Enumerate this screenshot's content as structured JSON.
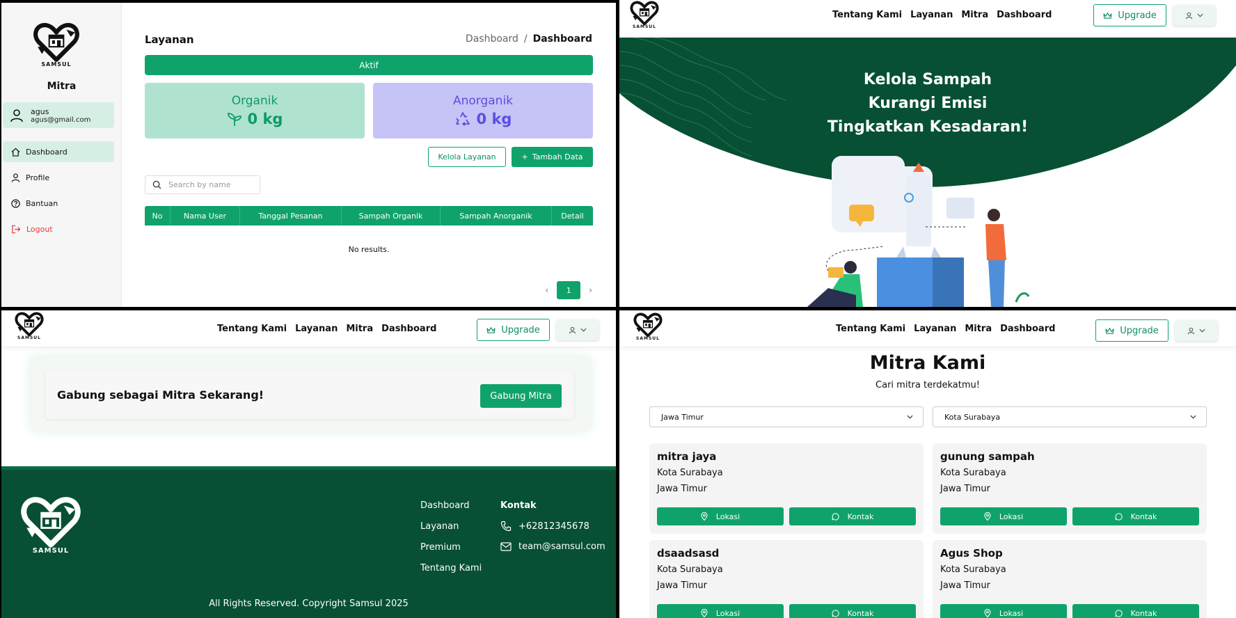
{
  "brand": {
    "name": "SAMSUL",
    "primary": "#0fa36b",
    "dark": "#075033"
  },
  "dashboard": {
    "role": "Mitra",
    "user": {
      "name": "agus",
      "email": "agus@gmail.com"
    },
    "sidebar": [
      {
        "label": "Dashboard",
        "icon": "home-icon"
      },
      {
        "label": "Profile",
        "icon": "user-icon"
      },
      {
        "label": "Bantuan",
        "icon": "help-icon"
      },
      {
        "label": "Logout",
        "icon": "logout-icon"
      }
    ],
    "title": "Layanan",
    "breadcrumb": [
      "Dashboard",
      "Dashboard"
    ],
    "breadcrumb_sep": "/",
    "status_bar": "Aktif",
    "stats": {
      "organik": {
        "label": "Organik",
        "value": "0 kg"
      },
      "anorganik": {
        "label": "Anorganik",
        "value": "0 kg"
      }
    },
    "buttons": {
      "kelola": "Kelola Layanan",
      "tambah": "Tambah Data"
    },
    "search_placeholder": "Search by name",
    "table": {
      "columns": [
        "No",
        "Nama User",
        "Tanggal Pesanan",
        "Sampah Organik",
        "Sampah Anorganik",
        "Detail"
      ],
      "rows": [],
      "empty": "No results."
    },
    "pagination": {
      "current": "1",
      "prev": "‹",
      "next": "›"
    }
  },
  "nav": {
    "links": [
      "Tentang Kami",
      "Layanan",
      "Mitra",
      "Dashboard"
    ],
    "upgrade": "Upgrade"
  },
  "hero": {
    "lines": [
      "Kelola Sampah",
      "Kurangi Emisi",
      "Tingkatkan Kesadaran!"
    ]
  },
  "cta": {
    "text": "Gabung sebagai Mitra Sekarang!",
    "button": "Gabung Mitra"
  },
  "footer": {
    "links": [
      "Dashboard",
      "Layanan",
      "Premium",
      "Tentang Kami"
    ],
    "contact_title": "Kontak",
    "phone": "+62812345678",
    "email": "team@samsul.com",
    "copyright": "All Rights Reserved. Copyright Samsul 2025"
  },
  "mitra": {
    "title": "Mitra Kami",
    "subtitle": "Cari mitra terdekatmu!",
    "province": "Jawa Timur",
    "city": "Kota Surabaya",
    "btn_lokasi": "Lokasi",
    "btn_kontak": "Kontak",
    "cards": [
      {
        "name": "mitra jaya",
        "city": "Kota Surabaya",
        "province": "Jawa Timur"
      },
      {
        "name": "gunung sampah",
        "city": "Kota Surabaya",
        "province": "Jawa Timur"
      },
      {
        "name": "dsaadsasd",
        "city": "Kota Surabaya",
        "province": "Jawa Timur"
      },
      {
        "name": "Agus Shop",
        "city": "Kota Surabaya",
        "province": "Jawa Timur"
      }
    ]
  }
}
